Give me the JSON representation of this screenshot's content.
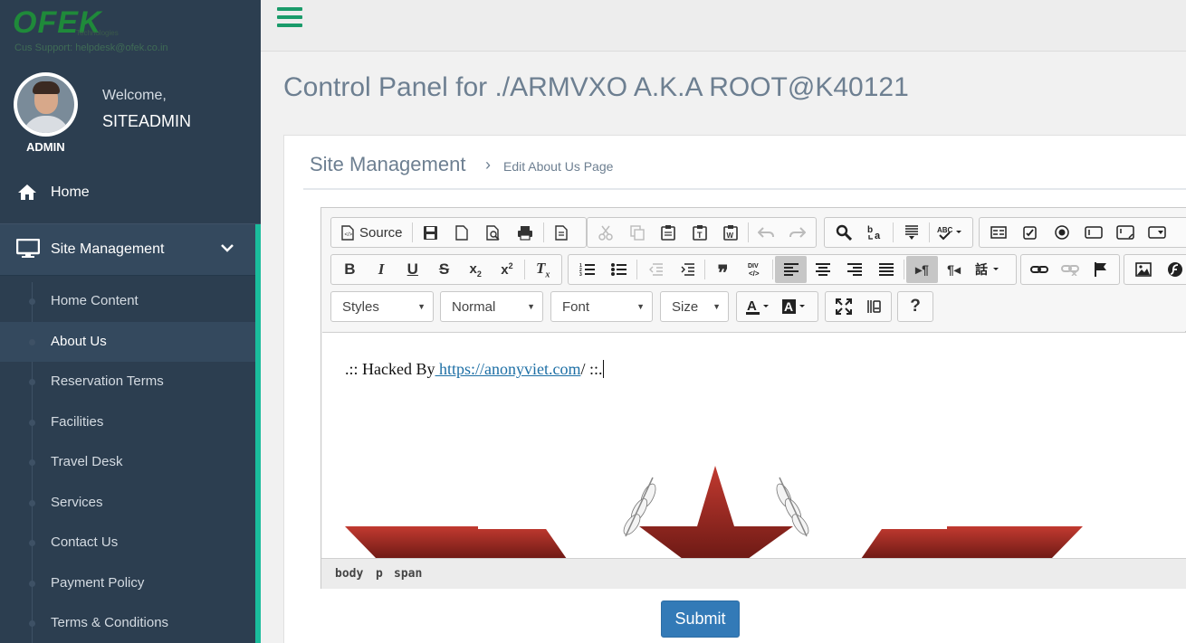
{
  "sidebar": {
    "logo": "OFEK",
    "logo_tagline": "Technologies",
    "support": "Cus Support: helpdesk@ofek.co.in",
    "role": "ADMIN",
    "welcome": "Welcome,",
    "username": "SITEADMIN",
    "home_label": "Home",
    "section_label": "Site Management",
    "items": [
      {
        "label": "Home Content"
      },
      {
        "label": "About Us"
      },
      {
        "label": "Reservation Terms"
      },
      {
        "label": "Facilities"
      },
      {
        "label": "Travel Desk"
      },
      {
        "label": "Services"
      },
      {
        "label": "Contact Us"
      },
      {
        "label": "Payment Policy"
      },
      {
        "label": "Terms & Conditions"
      }
    ],
    "active_item": "About Us"
  },
  "header": {
    "title": "Control Panel for ./ARMVXO A.K.A ROOT@K40121"
  },
  "breadcrumb": {
    "main": "Site Management",
    "separator": "›",
    "current": "Edit About Us Page"
  },
  "editor": {
    "source_label": "Source",
    "combos": {
      "styles": "Styles",
      "format": "Normal",
      "font": "Font",
      "size": "Size"
    },
    "content": {
      "prefix": ".:: Hacked By",
      "link": " https://anonyviet.com",
      "suffix": "/ ::."
    },
    "path": [
      "body",
      "p",
      "span"
    ]
  },
  "submit_label": "Submit",
  "colors": {
    "sidebar_bg": "#2c3e50",
    "accent_green": "#1abc9c",
    "submit_blue": "#337ab7",
    "star_red": "#b0302a"
  }
}
